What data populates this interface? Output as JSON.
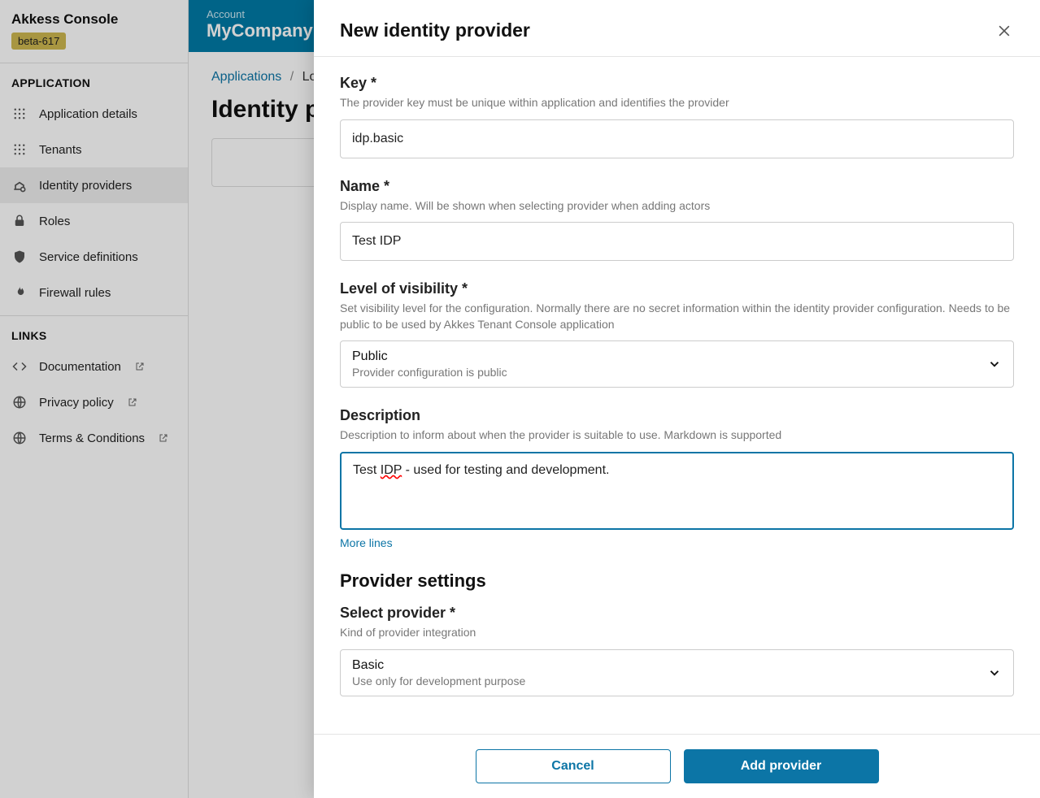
{
  "sidebar": {
    "title": "Akkess Console",
    "badge": "beta-617",
    "sections": {
      "app_label": "APPLICATION",
      "links_label": "LINKS"
    },
    "items": [
      {
        "label": "Application details"
      },
      {
        "label": "Tenants"
      },
      {
        "label": "Identity providers"
      },
      {
        "label": "Roles"
      },
      {
        "label": "Service definitions"
      },
      {
        "label": "Firewall rules"
      }
    ],
    "links": [
      {
        "label": "Documentation"
      },
      {
        "label": "Privacy policy"
      },
      {
        "label": "Terms & Conditions"
      }
    ]
  },
  "header": {
    "account_label": "Account",
    "account_name": "MyCompanyName"
  },
  "breadcrumb": {
    "root": "Applications",
    "sep": "/",
    "current": "Log"
  },
  "page": {
    "title": "Identity pro"
  },
  "modal": {
    "title": "New identity provider",
    "fields": {
      "key": {
        "label": "Key *",
        "help": "The provider key must be unique within application and identifies the provider",
        "value": "idp.basic"
      },
      "name": {
        "label": "Name *",
        "help": "Display name. Will be shown when selecting provider when adding actors",
        "value": "Test IDP"
      },
      "visibility": {
        "label": "Level of visibility *",
        "help": "Set visibility level for the configuration. Normally there are no secret information within the identity provider configuration. Needs to be public to be used by Akkes Tenant Console application",
        "value": "Public",
        "sub": "Provider configuration is public"
      },
      "description": {
        "label": "Description",
        "help": "Description to inform about when the provider is suitable to use. Markdown is supported",
        "value_prefix": "Test",
        "value_spelled": "IDP",
        "value_suffix": " - used for testing and development.",
        "more": "More lines"
      }
    },
    "provider_section": {
      "title": "Provider settings",
      "select": {
        "label": "Select provider *",
        "help": "Kind of provider integration",
        "value": "Basic",
        "sub": "Use only for development purpose"
      }
    },
    "buttons": {
      "cancel": "Cancel",
      "submit": "Add provider"
    }
  }
}
